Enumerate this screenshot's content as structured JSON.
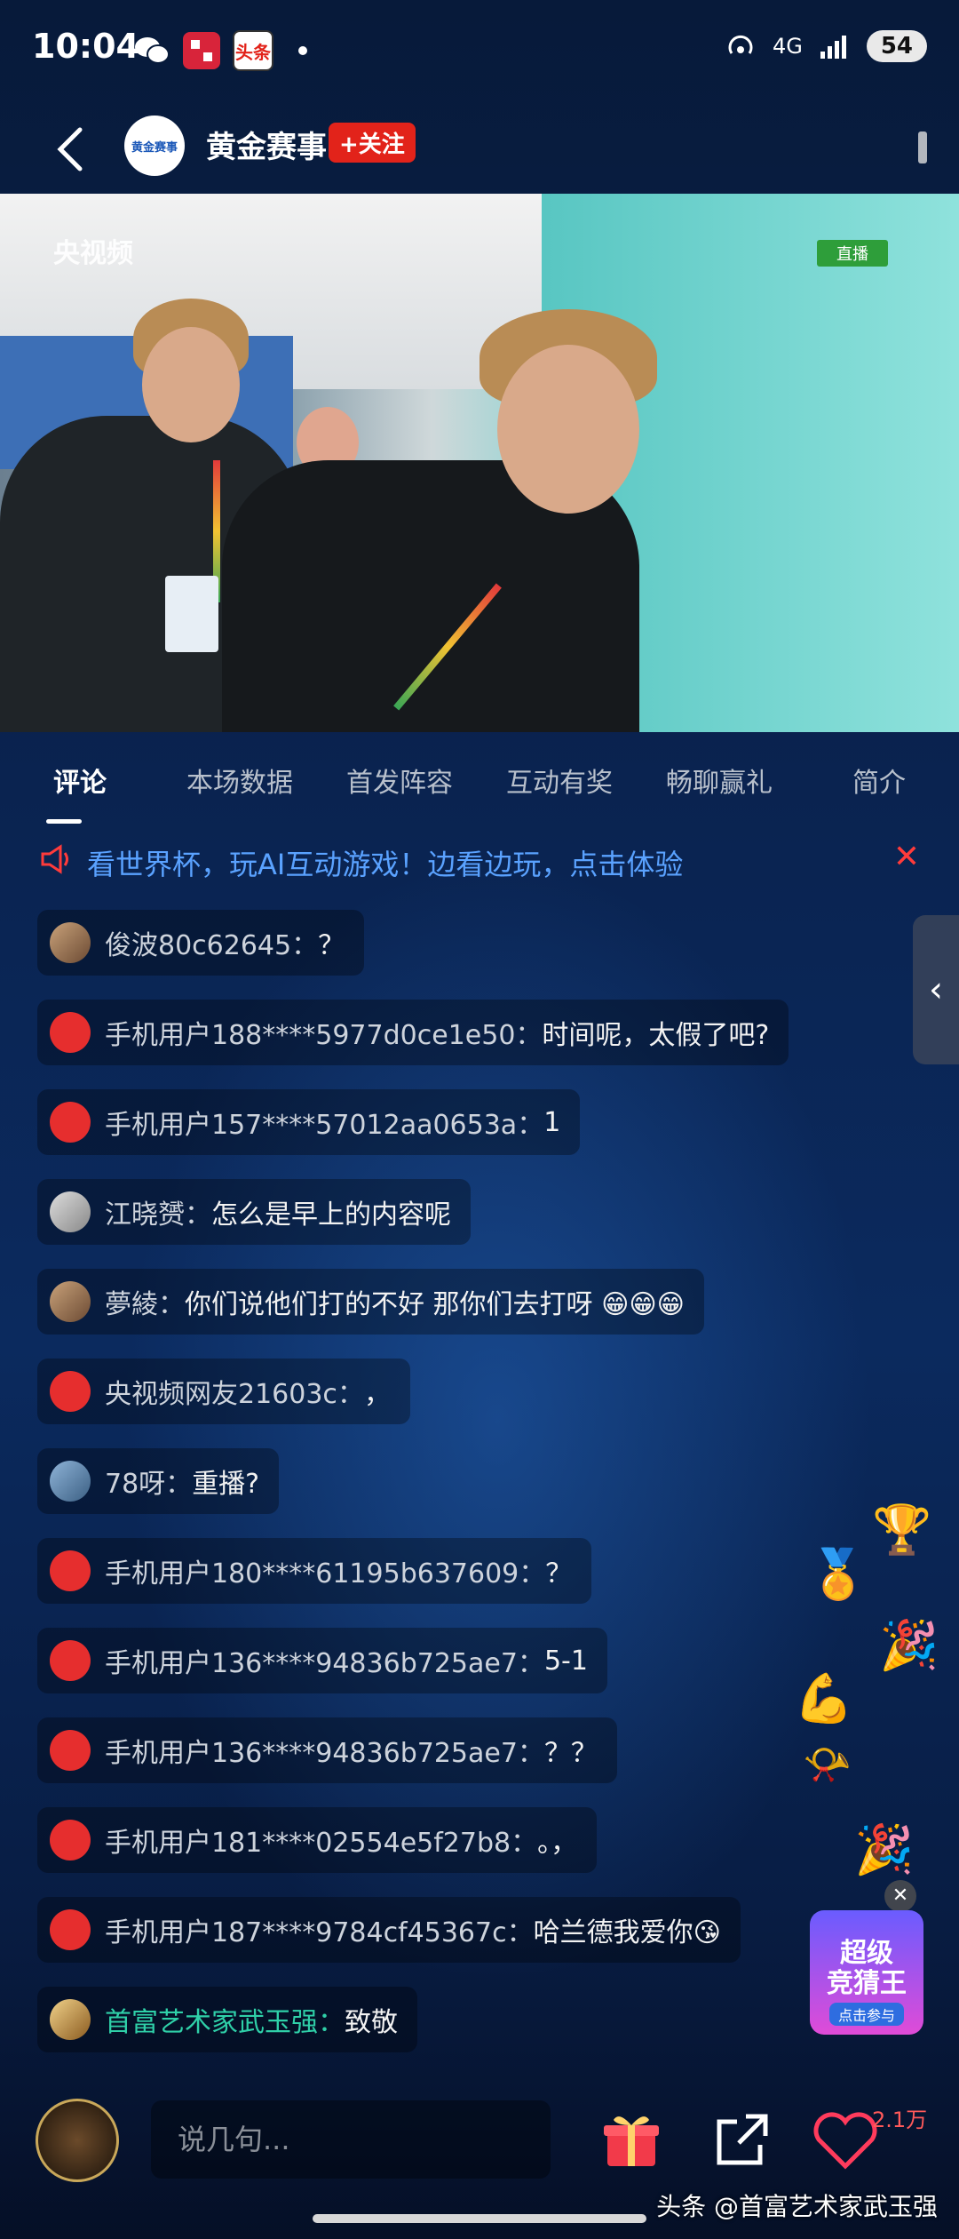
{
  "status_bar": {
    "time": "10:04",
    "network": "4G",
    "battery": "54",
    "apps": [
      "wechat-icon",
      "app-icon",
      "toutiao-icon"
    ],
    "toutiao_label": "头条"
  },
  "header": {
    "channel_name": "黄金赛事",
    "follow_label": "+关注",
    "avatar_text": "黄金赛事"
  },
  "video": {
    "watermark": "央视频",
    "live_tag": "直播"
  },
  "tabs": [
    {
      "label": "评论",
      "active": true
    },
    {
      "label": "本场数据"
    },
    {
      "label": "首发阵容"
    },
    {
      "label": "互动有奖"
    },
    {
      "label": "畅聊赢礼"
    },
    {
      "label": "简介"
    }
  ],
  "banner": {
    "text": "看世界杯，玩AI互动游戏！边看边玩，点击体验",
    "close": "✕"
  },
  "side_tab": "‹",
  "comments": [
    {
      "user": "俊波80c62645：",
      "text": "？"
    },
    {
      "user": "手机用户188****5977d0ce1e50：",
      "text": "时间呢，太假了吧?"
    },
    {
      "user": "手机用户157****57012aa0653a：",
      "text": "1"
    },
    {
      "user": "江晓赟：",
      "text": "怎么是早上的内容呢"
    },
    {
      "user": "夢綾：",
      "text": "你们说他们打的不好 那你们去打呀 😁😁😁"
    },
    {
      "user": "央视频网友21603c：",
      "text": "，"
    },
    {
      "user": "78呀：",
      "text": "重播?"
    },
    {
      "user": "手机用户180****61195b637609：",
      "text": "？"
    },
    {
      "user": "手机用户136****94836b725ae7：",
      "text": "5-1"
    },
    {
      "user": "手机用户136****94836b725ae7：",
      "text": "？？"
    },
    {
      "user": "手机用户181****02554e5f27b8：",
      "text": "。，"
    },
    {
      "user": "手机用户187****9784cf45367c：",
      "text": "哈兰德我爱你😘"
    },
    {
      "user": "首富艺术家武玉强：",
      "text": "致敬"
    }
  ],
  "promo": {
    "title_line1": "超级",
    "title_line2": "竞猜王",
    "subtitle": "点击参与",
    "close": "✕"
  },
  "bottom_bar": {
    "input_placeholder": "说几句...",
    "like_count": "2.1万"
  },
  "footer": {
    "watermark": "头条 @首富艺术家武玉强"
  },
  "colors": {
    "accent_red": "#e2231a",
    "highlight_user": "#2fd0a8",
    "banner_link": "#5aa2ff"
  }
}
